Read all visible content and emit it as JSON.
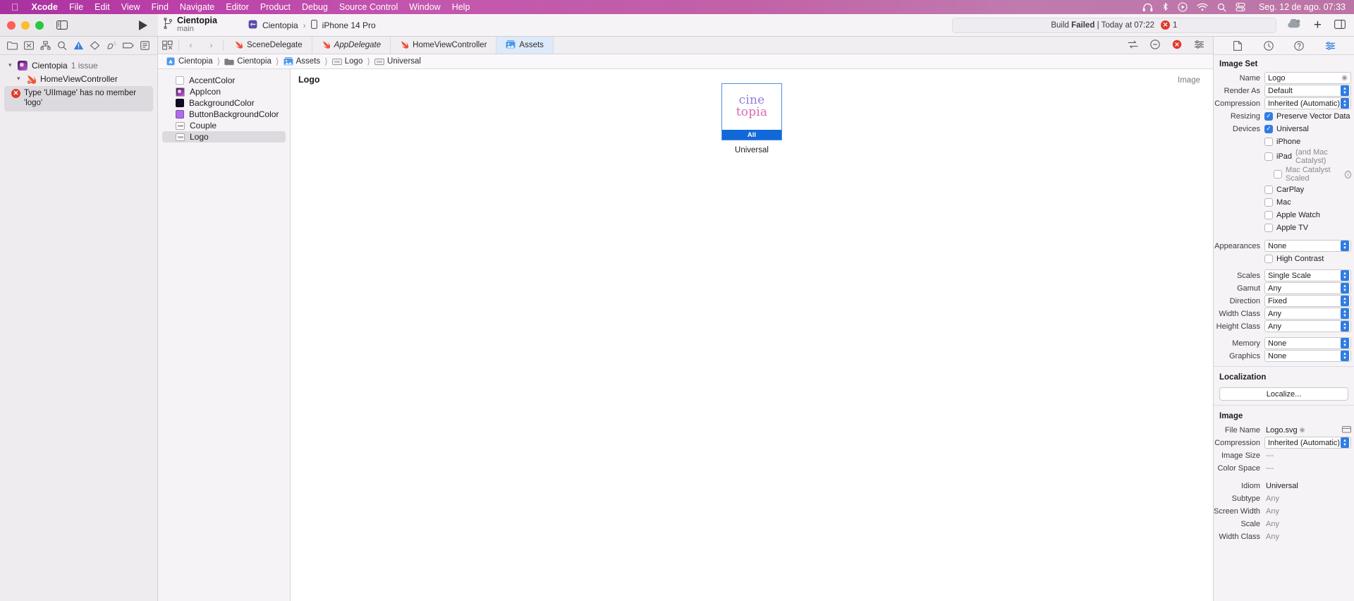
{
  "menubar": {
    "apple": "apple-logo",
    "items": [
      "Xcode",
      "File",
      "Edit",
      "View",
      "Find",
      "Navigate",
      "Editor",
      "Product",
      "Debug",
      "Source Control",
      "Window",
      "Help"
    ],
    "status_icons": [
      "headphones-icon",
      "bluetooth-icon",
      "now-playing-icon",
      "wifi-icon",
      "spotlight-search-icon",
      "control-center-icon"
    ],
    "clock": "Seg. 12 de ago.  07:33"
  },
  "toolbar": {
    "window_controls": [
      "close",
      "minimize",
      "zoom"
    ],
    "sidebar_toggle": "sidebar-toggle-icon",
    "run_button": "run-icon",
    "branch_icon": "source-control-branch-icon",
    "project_name": "Cientopia",
    "branch_name": "main",
    "scheme_name": "Cientopia",
    "scheme_separator": "›",
    "destination_name": "iPhone 14 Pro",
    "build_status_prefix": "Build",
    "build_status_state": "Failed",
    "build_status_sep": "|",
    "build_status_time": "Today at 07:22",
    "error_count": "1",
    "cloud_icon": "cloud-icon",
    "add_button": "+",
    "panel_toggle": "inspector-toggle-icon"
  },
  "navigator": {
    "tabs": [
      {
        "name": "project-navigator",
        "icon": "folder-icon",
        "active": false
      },
      {
        "name": "source-control-navigator",
        "icon": "source-control-icon",
        "active": false
      },
      {
        "name": "symbol-navigator",
        "icon": "hierarchy-icon",
        "active": false
      },
      {
        "name": "find-navigator",
        "icon": "search-icon",
        "active": false
      },
      {
        "name": "issue-navigator",
        "icon": "warning-triangle-icon",
        "active": true
      },
      {
        "name": "test-navigator",
        "icon": "diamond-icon",
        "active": false
      },
      {
        "name": "debug-navigator",
        "icon": "debug-spray-icon",
        "active": false
      },
      {
        "name": "breakpoint-navigator",
        "icon": "breakpoint-tag-icon",
        "active": false
      },
      {
        "name": "report-navigator",
        "icon": "report-icon",
        "active": false
      }
    ],
    "tree": {
      "project_label": "Cientopia",
      "project_issue_count": "1 issue",
      "file_label": "HomeViewController",
      "issue_badge": "!",
      "issue_text": "Type 'UIImage' has no member 'logo'"
    }
  },
  "editor": {
    "tab_controls": {
      "layout_icon": "editor-layout-icon",
      "back": "‹",
      "forward": "›"
    },
    "tabs": [
      {
        "label": "SceneDelegate",
        "icon": "swift-file-icon",
        "italic": false,
        "active": false
      },
      {
        "label": "AppDelegate",
        "icon": "swift-file-icon",
        "italic": true,
        "active": false
      },
      {
        "label": "HomeViewController",
        "icon": "swift-file-icon",
        "italic": false,
        "active": false
      },
      {
        "label": "Assets",
        "icon": "assets-catalog-icon",
        "italic": false,
        "active": true
      }
    ],
    "tab_right_controls": [
      "compare-icon",
      "minimap-icon",
      "error-badge-icon",
      "adjust-icon"
    ],
    "breadcrumb": [
      {
        "label": "Cientopia",
        "icon": "project-icon"
      },
      {
        "label": "Cientopia",
        "icon": "folder-icon"
      },
      {
        "label": "Assets",
        "icon": "assets-catalog-icon"
      },
      {
        "label": "Logo",
        "icon": "image-set-icon"
      },
      {
        "label": "Universal",
        "icon": "image-set-icon"
      }
    ],
    "asset_list": [
      {
        "label": "AccentColor",
        "kind": "color",
        "color": "#ffffff",
        "selected": false
      },
      {
        "label": "AppIcon",
        "kind": "appicon",
        "color": "",
        "selected": false
      },
      {
        "label": "BackgroundColor",
        "kind": "color",
        "color": "#120b26",
        "selected": false
      },
      {
        "label": "ButtonBackgroundColor",
        "kind": "color",
        "color": "#b06bf0",
        "selected": false
      },
      {
        "label": "Couple",
        "kind": "image",
        "color": "",
        "selected": false
      },
      {
        "label": "Logo",
        "kind": "image",
        "color": "",
        "selected": true
      }
    ],
    "canvas": {
      "title": "Logo",
      "kind_label": "Image",
      "thumbnail": {
        "logo_line1": "cine",
        "logo_line2": "topia",
        "badge": "All",
        "badge_color": "#1168d9"
      },
      "caption": "Universal"
    }
  },
  "inspector": {
    "tabs": [
      {
        "name": "file-inspector",
        "icon": "document-icon",
        "active": false
      },
      {
        "name": "history-inspector",
        "icon": "clock-icon",
        "active": false
      },
      {
        "name": "quick-help-inspector",
        "icon": "help-icon",
        "active": false
      },
      {
        "name": "attributes-inspector",
        "icon": "sliders-icon",
        "active": true
      }
    ],
    "image_set": {
      "section_title": "Image Set",
      "name_label": "Name",
      "name_value": "Logo",
      "render_as_label": "Render As",
      "render_as_value": "Default",
      "compression_label": "Compression",
      "compression_value": "Inherited (Automatic)",
      "resizing_label": "Resizing",
      "resizing_checkbox_label": "Preserve Vector Data",
      "resizing_checked": true,
      "devices_label": "Devices",
      "devices": [
        {
          "label": "Universal",
          "checked": true,
          "note": ""
        },
        {
          "label": "iPhone",
          "checked": false,
          "note": ""
        },
        {
          "label": "iPad",
          "checked": false,
          "note": "(and Mac Catalyst)"
        },
        {
          "label": "Mac Catalyst Scaled",
          "checked": false,
          "note": "",
          "info": true,
          "indent": true
        },
        {
          "label": "CarPlay",
          "checked": false,
          "note": ""
        },
        {
          "label": "Mac",
          "checked": false,
          "note": ""
        },
        {
          "label": "Apple Watch",
          "checked": false,
          "note": ""
        },
        {
          "label": "Apple TV",
          "checked": false,
          "note": ""
        }
      ],
      "appearances_label": "Appearances",
      "appearances_value": "None",
      "high_contrast_label": "High Contrast",
      "high_contrast_checked": false,
      "scales_label": "Scales",
      "scales_value": "Single Scale",
      "gamut_label": "Gamut",
      "gamut_value": "Any",
      "direction_label": "Direction",
      "direction_value": "Fixed",
      "width_class_label": "Width Class",
      "width_class_value": "Any",
      "height_class_label": "Height Class",
      "height_class_value": "Any",
      "memory_label": "Memory",
      "memory_value": "None",
      "graphics_label": "Graphics",
      "graphics_value": "None"
    },
    "localization": {
      "section_title": "Localization",
      "button_label": "Localize..."
    },
    "image": {
      "section_title": "Image",
      "file_name_label": "File Name",
      "file_name_value": "Logo.svg",
      "compression_label": "Compression",
      "compression_value": "Inherited (Automatic)",
      "image_size_label": "Image Size",
      "image_size_value": "---",
      "color_space_label": "Color Space",
      "color_space_value": "---",
      "idiom_label": "Idiom",
      "idiom_value": "Universal",
      "subtype_label": "Subtype",
      "subtype_value": "Any",
      "screen_width_label": "Screen Width",
      "screen_width_value": "Any",
      "scale_label": "Scale",
      "scale_value": "Any",
      "width_class_label": "Width Class",
      "width_class_value": "Any"
    }
  }
}
